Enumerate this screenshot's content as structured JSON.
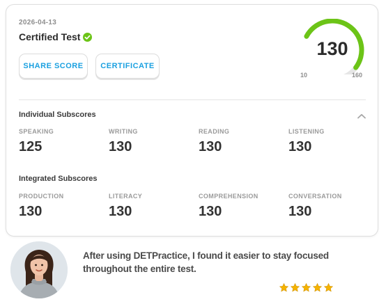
{
  "header": {
    "date": "2026-04-13",
    "title": "Certified Test",
    "share_label": "SHARE SCORE",
    "certificate_label": "CERTIFICATE"
  },
  "gauge": {
    "score": "130",
    "min": "10",
    "max": "160",
    "fill_fraction": 0.8,
    "color": "#6cc417",
    "track_color": "#e6e6e6"
  },
  "individual": {
    "title": "Individual Subscores",
    "items": [
      {
        "label": "SPEAKING",
        "value": "125"
      },
      {
        "label": "WRITING",
        "value": "130"
      },
      {
        "label": "READING",
        "value": "130"
      },
      {
        "label": "LISTENING",
        "value": "130"
      }
    ]
  },
  "integrated": {
    "title": "Integrated Subscores",
    "items": [
      {
        "label": "PRODUCTION",
        "value": "130"
      },
      {
        "label": "LITERACY",
        "value": "130"
      },
      {
        "label": "COMPREHENSION",
        "value": "130"
      },
      {
        "label": "CONVERSATION",
        "value": "130"
      }
    ]
  },
  "testimonial": {
    "quote": "After using DETPractice, I found it easier to stay focused throughout the entire test.",
    "rating": 5,
    "star_color": "#f5b301"
  },
  "colors": {
    "accent_blue": "#1aa0e0",
    "check_green": "#6cc417"
  }
}
